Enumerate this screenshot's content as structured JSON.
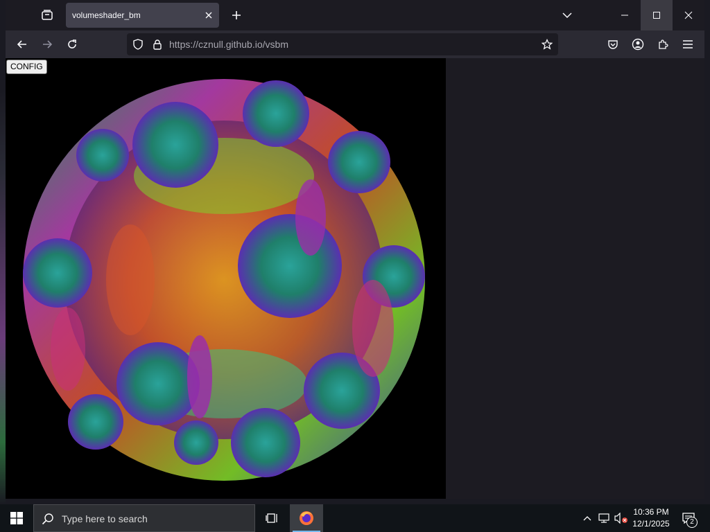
{
  "browser": {
    "tab": {
      "title": "volumeshader_bm"
    },
    "url": {
      "host": "https://cznull.github.io",
      "path": "/vsbm"
    }
  },
  "page": {
    "config_label": "CONFIG"
  },
  "taskbar": {
    "search_placeholder": "Type here to search",
    "time": "10:36 PM",
    "date": "12/1/2025",
    "notification_count": "2"
  },
  "colors": {
    "tab_active": "#42414d",
    "navbar": "#2b2a33",
    "titlebar": "#1c1b22",
    "taskbar": "#101418",
    "accent": "#76b9ed"
  }
}
